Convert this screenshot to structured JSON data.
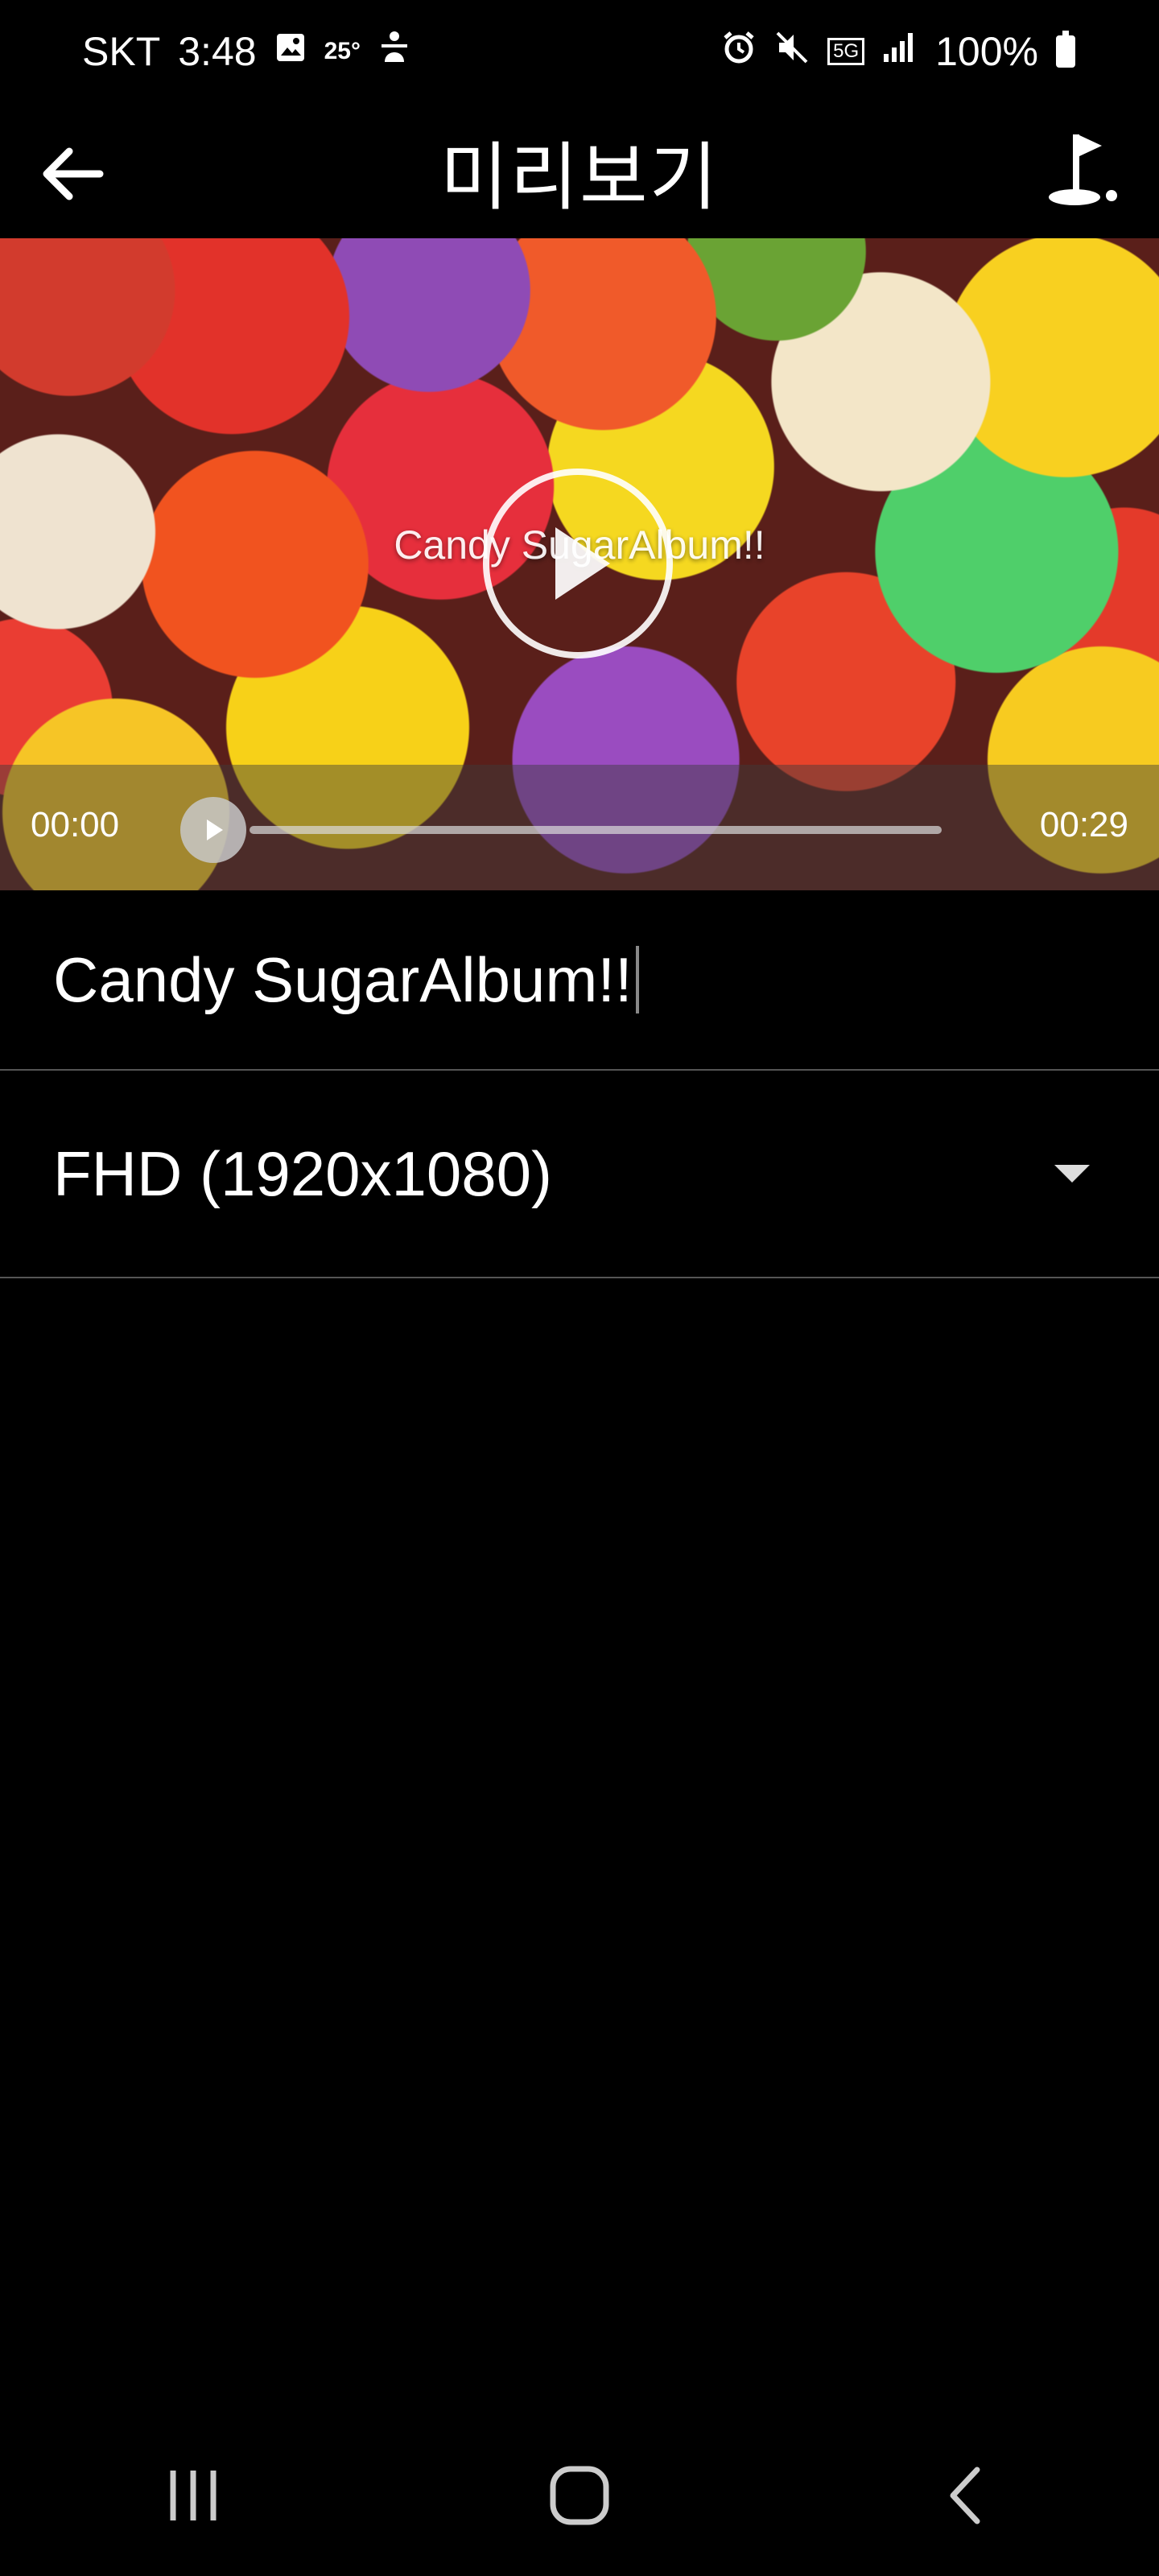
{
  "status_bar": {
    "carrier": "SKT",
    "time": "3:48",
    "temperature": "25°",
    "network": "5G",
    "battery": "100%"
  },
  "app_bar": {
    "title": "미리보기"
  },
  "video": {
    "caption": "Candy SugarAlbum!!",
    "current_time": "00:00",
    "duration": "00:29",
    "progress": 0
  },
  "form": {
    "title_value": "Candy SugarAlbum!!",
    "resolution_selected": "FHD (1920x1080)"
  },
  "icons": {
    "back": "arrow-left-icon",
    "share": "golf-flag-icon",
    "play": "play-icon",
    "dropdown": "caret-down-icon",
    "nav_recent": "recent-apps-icon",
    "nav_home": "home-icon",
    "nav_back": "chevron-left-icon"
  }
}
